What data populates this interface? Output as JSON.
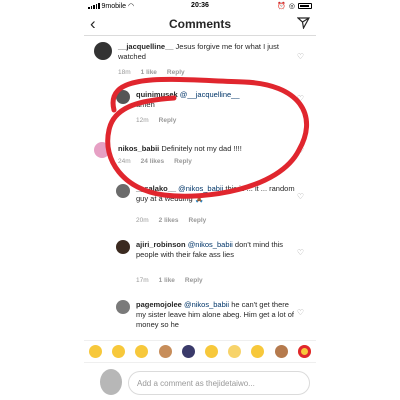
{
  "status_bar": {
    "carrier": "9mobile",
    "time": "20:36"
  },
  "header": {
    "title": "Comments"
  },
  "comments": [
    {
      "user": "__jacquelline__",
      "text": "Jesus forgive me for what I just watched",
      "age": "18m",
      "likes": "1 like",
      "reply": "Reply"
    },
    {
      "user": "quinimusek",
      "mention": "@__jacquelline__",
      "text": "amen",
      "age": "12m",
      "reply": "Reply"
    },
    {
      "user": "nikos_babii",
      "text": "Definitely not my dad !!!!",
      "age": "24m",
      "likes": "24 likes",
      "reply": "Reply"
    },
    {
      "user": "__salako__",
      "mention": "@nikos_babii",
      "text": "this is ... it ... random guy at a wedding",
      "age": "20m",
      "likes": "2 likes",
      "reply": "Reply"
    },
    {
      "user": "ajiri_robinson",
      "mention": "@nikos_babii",
      "text": "don't mind this people with their fake ass lies",
      "age": "17m",
      "likes": "1 like",
      "reply": "Reply"
    },
    {
      "user": "pagemojolee",
      "mention": "@nikos_babii",
      "text": "he can't get there my sister leave him alone abeg. Him get a lot of money so he"
    }
  ],
  "emoji_bar": [
    "face-with-tears-of-joy",
    "winking-tongue-face",
    "heart-eyes-face",
    "clapping-hands",
    "person-raising-hand",
    "smiling-face",
    "relieved-face",
    "thinking-face",
    "thumbs-up",
    "heart-eyes-face-2"
  ],
  "add_comment": {
    "placeholder": "Add a comment as thejidetaiwo..."
  },
  "colors": {
    "annotation_red": "#e0262e",
    "accent_blue": "#3897f0"
  }
}
